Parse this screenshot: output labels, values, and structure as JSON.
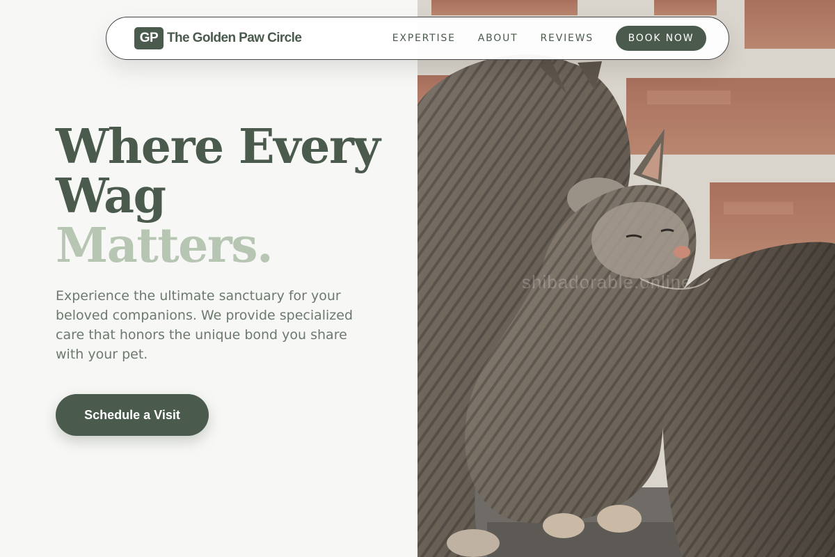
{
  "brand": {
    "badge": "GP",
    "name": "The Golden Paw Circle"
  },
  "nav": {
    "links": [
      {
        "label": "EXPERTISE"
      },
      {
        "label": "ABOUT"
      },
      {
        "label": "REVIEWS"
      }
    ],
    "cta_label": "BOOK NOW"
  },
  "hero": {
    "title_line1": "Where Every Wag",
    "title_accent": "Matters.",
    "description": "Experience the ultimate sanctuary for your beloved companions. We provide specialized care that honors the unique bond you share with your pet.",
    "cta_label": "Schedule a Visit"
  },
  "photo": {
    "subject": "two tabby cats cuddling against a brick wall",
    "watermark": "shibadorable.online"
  },
  "colors": {
    "primary": "#4a5a4c",
    "accent": "#b7c5b3",
    "background": "#f7f7f5",
    "body_text": "#6c7a6e"
  }
}
